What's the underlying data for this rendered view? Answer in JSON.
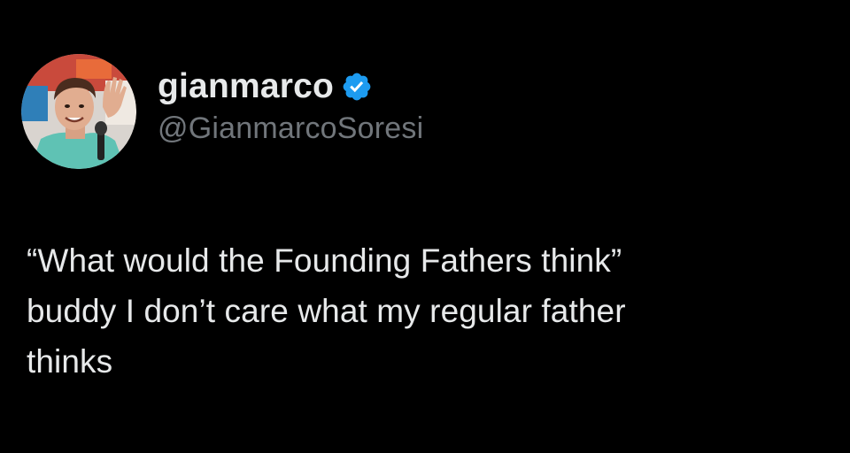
{
  "author": {
    "display_name": "gianmarco",
    "handle": "@GianmarcoSoresi",
    "verified_icon": "verified-badge-icon",
    "avatar_icon": "profile-photo"
  },
  "tweet": {
    "text_line_1": "“What would the Founding Fathers think”",
    "text_line_2": "buddy I don’t care what my regular father",
    "text_line_3": "thinks"
  },
  "colors": {
    "background": "#000000",
    "primary_text": "#e7e9ea",
    "secondary_text": "#71767b",
    "verified_blue": "#1d9bf0"
  }
}
